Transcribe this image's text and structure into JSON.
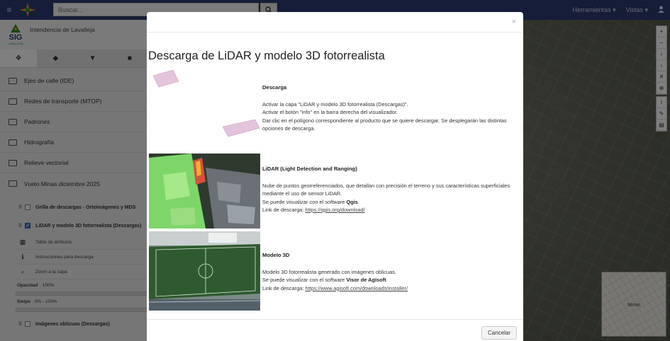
{
  "navbar": {
    "search_placeholder": "Buscar...",
    "menu_herramientas": "Herramientas",
    "menu_vistas": "Vistas",
    "caret": "▾"
  },
  "sidebar": {
    "org_name": "Intendencia de Lavalleja",
    "logo_text": "SIG",
    "logo_sub": "LAVALLEJA",
    "tabs": [
      "layers-icon",
      "tags-icon",
      "filter-icon",
      "print-icon"
    ],
    "folders": [
      "Ejes de calle (IDE)",
      "Redes de transporte (MTOP)",
      "Padrones",
      "Hidrografía",
      "Relieve vectorial",
      "Vuelo Minas diciembre 2025"
    ],
    "layers": [
      {
        "label": "Grilla de descargas - Ortoimágenes y MDS",
        "checked": false
      },
      {
        "label": "LiDAR y modelo 3D fotorrealista (Descargas)",
        "checked": true
      }
    ],
    "tools": [
      "Tabla de atributos",
      "Instrucciones para descarga",
      "Zoom a la capa"
    ],
    "opacity_label": "Opacidad",
    "opacity_value": "100%",
    "swipe_label": "Swipe",
    "swipe_value": "0% - 100%",
    "last_layer": "Imágenes oblicuas (Descargas)"
  },
  "map": {
    "minimap_label": "Minas"
  },
  "modal": {
    "title": "Descarga de LiDAR y modelo 3D fotorrealista",
    "close": "×",
    "sections": {
      "descarga": {
        "heading": "Descarga",
        "line1": "Activar la capa \"LiDAR y modelo 3D fotorrealista (Descargas)\".",
        "line2": "Activar el botón \"info\" en la barra derecha del visualizador.",
        "line3": "Dar clic en el polígono correspondiente al producto que se quiere descargar. Se desplegarán las distintas opciones de descarga."
      },
      "lidar": {
        "heading": "LiDAR (Light Detection and Ranging)",
        "line1": "Nube de puntos georreferenciados, que detallan con precisión el terreno y sus características superficiales mediante el uso de sensor LiDAR.",
        "line2_prefix": "Se puede visualizar con el software ",
        "software": "Qgis",
        "line2_suffix": ".",
        "link_prefix": "Link de descarga: ",
        "link": "https://qgis.org/download/"
      },
      "modelo3d": {
        "heading": "Modelo 3D",
        "line1": "Modelo 3D fotorrealista generado con imágenes oblicuas.",
        "line2_prefix": "Se puede visualizar con el software ",
        "software": "Visor de Agisoft",
        "line2_suffix": ".",
        "link_prefix": "Link de descarga: ",
        "link": "https://www.agisoft.com/downloads/installer/"
      }
    },
    "cancel_label": "Cancelar"
  }
}
